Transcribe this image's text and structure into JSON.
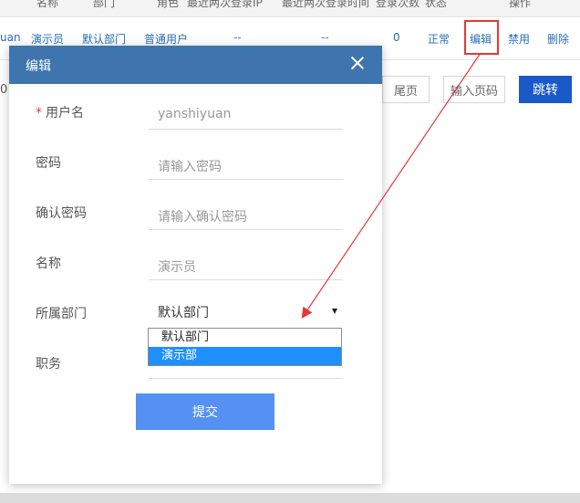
{
  "table": {
    "headers": [
      "名称",
      "部门",
      "角色",
      "最近两次登录IP",
      "最近两次登录时间",
      "登录次数",
      "状态",
      "操作"
    ],
    "row": {
      "username_fragment": "uan",
      "name": "演示员",
      "department": "默认部门",
      "role": "普通用户",
      "last_ip": "--",
      "last_time": "--",
      "login_count": "0",
      "status": "正常",
      "actions": {
        "edit": "编辑",
        "disable": "禁用",
        "delete": "删除"
      }
    }
  },
  "pager": {
    "left_fragment": "0",
    "last_page": "尾页",
    "page_input_placeholder": "输入页码",
    "jump": "跳转"
  },
  "modal": {
    "title": "编辑",
    "fields": {
      "username": {
        "label": "用户名",
        "required_mark": "*",
        "value": "yanshiyuan"
      },
      "password": {
        "label": "密码",
        "placeholder": "请输入密码"
      },
      "confirm_password": {
        "label": "确认密码",
        "placeholder": "请输入确认密码"
      },
      "name": {
        "label": "名称",
        "placeholder": "演示员"
      },
      "department": {
        "label": "所属部门",
        "selected": "默认部门",
        "options": [
          "默认部门",
          "演示部"
        ]
      },
      "position": {
        "label": "职务"
      }
    },
    "submit": "提交"
  },
  "colors": {
    "header": "#3f75ae",
    "submit": "#5591f2",
    "jump": "#1a59c8",
    "highlight": "#e53935",
    "option_selected": "#1e90ff"
  }
}
